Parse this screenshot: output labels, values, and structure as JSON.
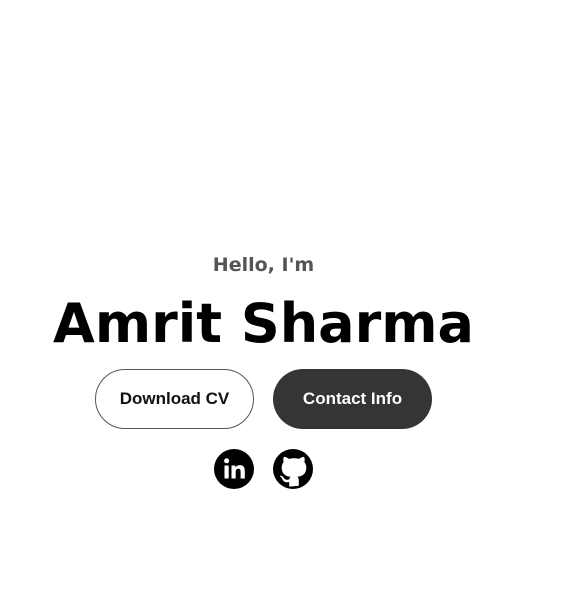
{
  "hero": {
    "greeting": "Hello, I'm",
    "name": "Amrit Sharma"
  },
  "buttons": {
    "download_cv": "Download CV",
    "contact_info": "Contact Info"
  },
  "socials": [
    {
      "icon": "linkedin-icon"
    },
    {
      "icon": "github-icon"
    }
  ],
  "colors": {
    "background": "#ffffff",
    "greeting_text": "#555555",
    "name_text": "#000000",
    "filled_button": "#353535",
    "outline_border": "#555555",
    "icon": "#000000"
  }
}
